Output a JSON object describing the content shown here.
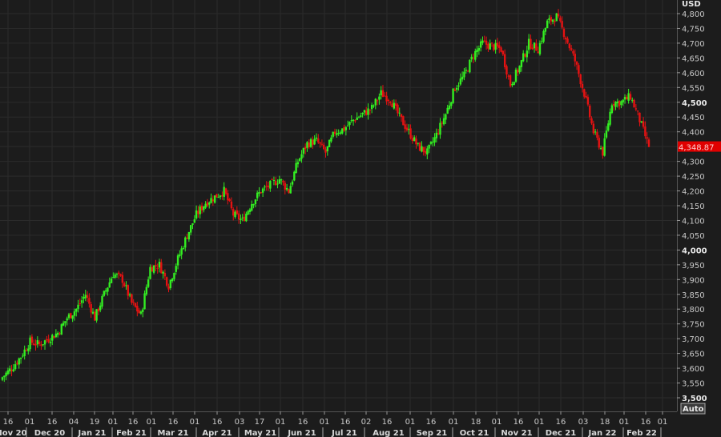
{
  "chart_data": {
    "type": "candlestick",
    "title": "",
    "currency_label": "USD",
    "last_price_label": "4,348.87",
    "last_price": 4348.87,
    "auto_button_label": "Auto",
    "ylim": [
      3500,
      4800
    ],
    "y_ticks": [
      4800,
      4750,
      4700,
      4650,
      4600,
      4550,
      4500,
      4450,
      4400,
      4350,
      4300,
      4250,
      4200,
      4150,
      4100,
      4050,
      4000,
      3950,
      3900,
      3850,
      3800,
      3750,
      3700,
      3650,
      3600,
      3550,
      3500
    ],
    "y_tick_labels": [
      "4,800",
      "4,750",
      "4,700",
      "4,650",
      "4,600",
      "4,550",
      "4,500",
      "4,450",
      "4,400",
      "4,300",
      "4,250",
      "4,200",
      "4,150",
      "4,100",
      "4,050",
      "4,000",
      "3,950",
      "3,900",
      "3,850",
      "3,800",
      "3,750",
      "3,700",
      "3,650",
      "3,600",
      "3,550",
      "3,500"
    ],
    "y_bold_labels": [
      "4,500",
      "4,000",
      "3,500"
    ],
    "x_tick_labels": [
      "16",
      "01",
      "16",
      "04",
      "19",
      "01",
      "16",
      "01",
      "16",
      "01",
      "16",
      "03",
      "17",
      "01",
      "16",
      "01",
      "16",
      "02",
      "16",
      "01",
      "16",
      "01",
      "18",
      "01",
      "16",
      "01",
      "16",
      "03",
      "18",
      "01",
      "16",
      "01"
    ],
    "month_labels": [
      "Nov 20",
      "Dec 20",
      "Jan 21",
      "Feb 21",
      "Mar 21",
      "Apr 21",
      "May 21",
      "Jun 21",
      "Jul 21",
      "Aug 21",
      "Sep 21",
      "Oct 21",
      "Nov 21",
      "Dec 21",
      "Jan 22",
      "Feb 22"
    ],
    "grid": true,
    "colors": {
      "up": "#33ee22",
      "down": "#e51212",
      "background": "#1c1c1c",
      "grid": "#2b2b2b",
      "price_tag": "#e00000"
    },
    "weekly_closes_approx": [
      3570,
      3600,
      3640,
      3690,
      3680,
      3700,
      3720,
      3770,
      3800,
      3850,
      3770,
      3850,
      3920,
      3900,
      3820,
      3780,
      3940,
      3950,
      3880,
      3970,
      4050,
      4120,
      4160,
      4180,
      4200,
      4120,
      4100,
      4160,
      4200,
      4220,
      4240,
      4200,
      4300,
      4360,
      4370,
      4330,
      4400,
      4410,
      4440,
      4460,
      4480,
      4530,
      4510,
      4450,
      4400,
      4350,
      4330,
      4390,
      4460,
      4550,
      4590,
      4660,
      4700,
      4690,
      4680,
      4560,
      4620,
      4700,
      4680,
      4770,
      4790,
      4720,
      4640,
      4530,
      4400,
      4330,
      4500,
      4500,
      4520,
      4440,
      4348.87
    ]
  }
}
